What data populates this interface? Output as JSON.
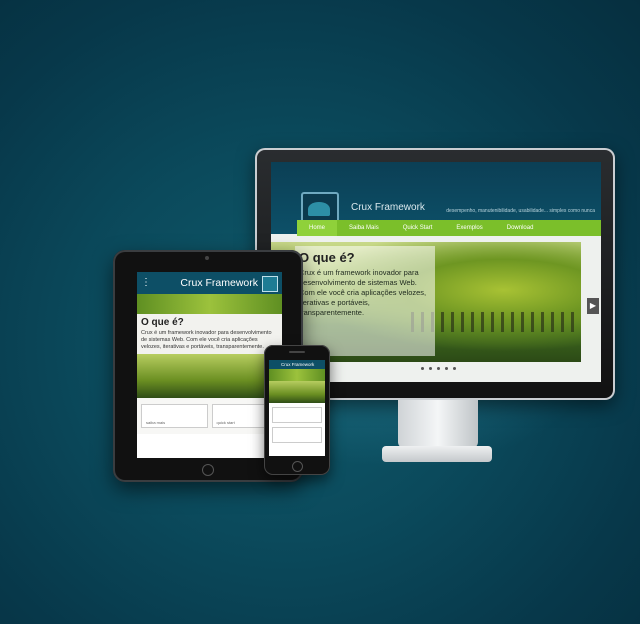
{
  "monitor": {
    "brand": "Crux Framework",
    "tagline": "desempenho, manutenibilidade, usabilidade... simples como nunca",
    "nav": [
      "Home",
      "Saiba Mais",
      "Quick Start",
      "Exemplos",
      "Download"
    ],
    "hero_title": "O que é?",
    "hero_text": "Crux é um framework inovador para desenvolvimento de sistemas Web. Com ele você cria aplicações velozes, iterativas e portáveis, transparentemente.",
    "arrow": "▶"
  },
  "tablet": {
    "menu_icon": "⋮",
    "brand": "Crux Framework",
    "title": "O que é?",
    "text": "Crux é um framework inovador para desenvolvimento de sistemas Web. Com ele você cria aplicações velozes, iterativas e portáveis, transparentemente.",
    "card1": "saiba mais",
    "card2": "quick start"
  },
  "phone": {
    "brand": "Crux Framework"
  },
  "colors": {
    "background": "#0b4a5c",
    "header": "#0d4f66",
    "nav_green": "#7bbf2a"
  }
}
